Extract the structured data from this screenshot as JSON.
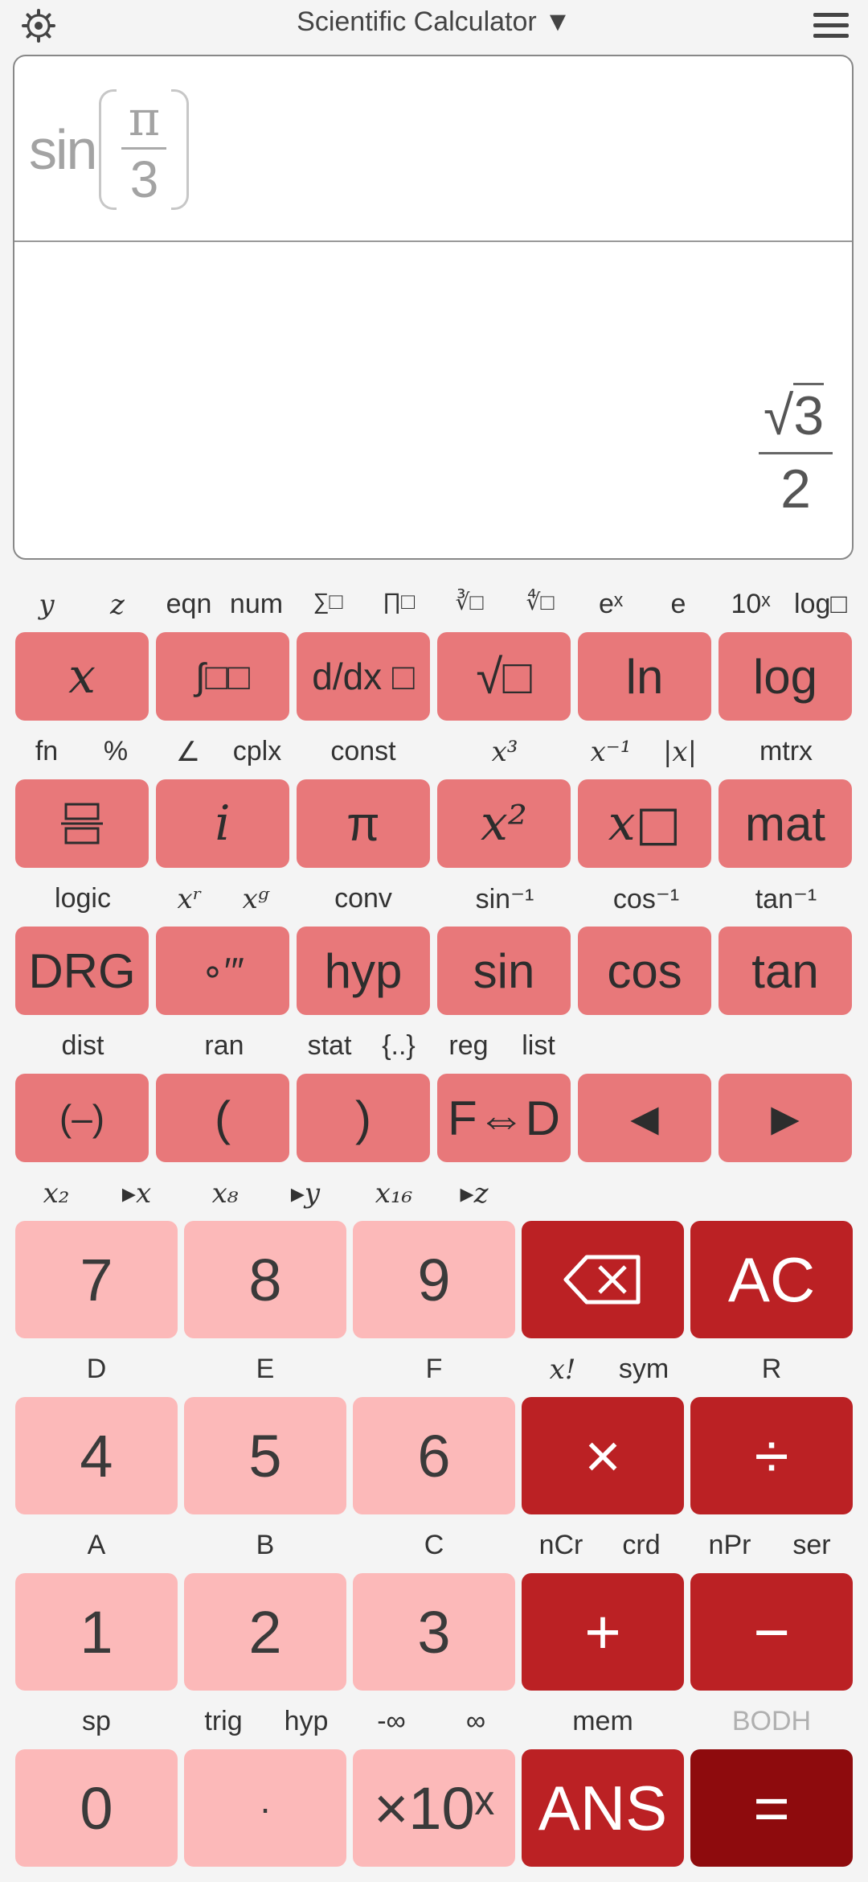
{
  "app": {
    "title": "Scientific Calculator ▼"
  },
  "display": {
    "expression": {
      "function": "sin",
      "numerator": "π",
      "denominator": "3"
    },
    "result": {
      "radical": "√",
      "radicand": "3",
      "denominator": "2"
    }
  },
  "labels": {
    "row1": [
      "y",
      "z",
      "eqn",
      "num",
      "∑□",
      "∏□",
      "∛□",
      "∜□",
      "eˣ",
      "e",
      "10ˣ",
      "log□"
    ],
    "row2": [
      "fn",
      "%",
      "∠",
      "cplx",
      "const",
      "x³",
      "x⁻¹",
      "|x|",
      "mtrx"
    ],
    "row3": [
      "logic",
      "xʳ",
      "xᵍ",
      "conv",
      "sin⁻¹",
      "cos⁻¹",
      "tan⁻¹"
    ],
    "row4": [
      "dist",
      "ran",
      "stat",
      "{..}",
      "reg",
      "list"
    ],
    "row5": [
      "x₂",
      "▸x",
      "x₈",
      "▸y",
      "x₁₆",
      "▸z"
    ],
    "row6": [
      "D",
      "E",
      "F",
      "x!",
      "sym",
      "R"
    ],
    "row7": [
      "A",
      "B",
      "C",
      "nCr",
      "crd",
      "nPr",
      "ser"
    ],
    "row8": [
      "sp",
      "trig",
      "hyp",
      "-∞",
      "∞",
      "mem",
      "BODH"
    ]
  },
  "keys": {
    "r1": [
      "x",
      "∫□□",
      "d/dx □",
      "√□",
      "ln",
      "log"
    ],
    "r2": [
      "▭▭",
      "i",
      "π",
      "x²",
      "x□",
      "mat"
    ],
    "r3": [
      "DRG",
      "∘′″",
      "hyp",
      "sin",
      "cos",
      "tan"
    ],
    "r4": [
      "(–)",
      "(",
      ")",
      "F⇔D",
      "◀",
      "▶"
    ],
    "r5": [
      "7",
      "8",
      "9",
      "⌫",
      "AC"
    ],
    "r6": [
      "4",
      "5",
      "6",
      "×",
      "÷"
    ],
    "r7": [
      "1",
      "2",
      "3",
      "+",
      "−"
    ],
    "r8": [
      "0",
      "·",
      "×10ˣ",
      "ANS",
      "="
    ]
  },
  "colors": {
    "function_key": "#e8787a",
    "digit_key": "#fcb9b9",
    "operator_key": "#bb2124",
    "equals_key": "#8e0b0d",
    "background": "#f4f4f4"
  }
}
